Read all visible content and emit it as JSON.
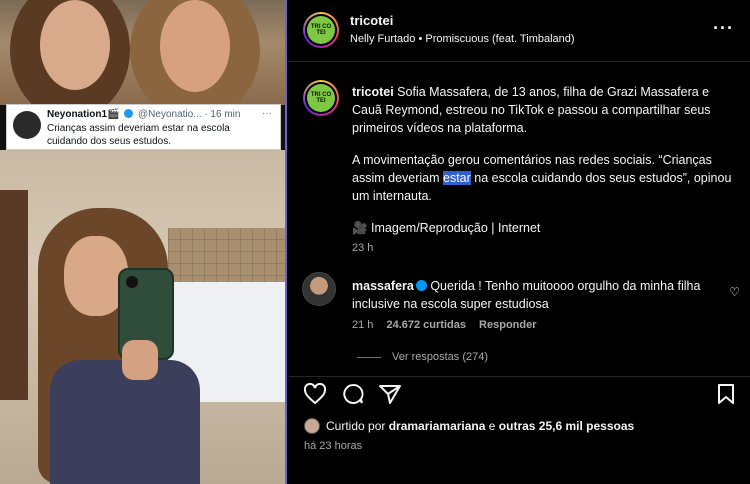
{
  "tweet": {
    "display_name": "Neyonation1",
    "display_name_emoji": "🎬",
    "handle": "@Neyonatio...",
    "time": "· 16 min",
    "more": "···",
    "text_line1": "Crianças assim deveriam estar na escola",
    "text_line2": "cuidando dos seus estudos."
  },
  "header": {
    "avatar_text": "TRI CO TEI",
    "username": "tricotei",
    "audio": "Nelly Furtado • Promiscuous (feat. Timbaland)",
    "more": "···"
  },
  "caption": {
    "username": "tricotei",
    "p1": " Sofia Massafera, de 13 anos, filha de Grazi Massafera e Cauã Reymond, estreou no TikTok e passou a compartilhar seus primeiros vídeos na plataforma.",
    "p2_before": "A movimentação gerou comentários nas redes sociais. “Crianças assim deveriam ",
    "p2_highlight": "estar",
    "p2_after": " na escola cuidando dos seus estudos”, opinou um internauta.",
    "p3_icon": "🎥",
    "p3": " Imagem/Reprodução | Internet",
    "time": "23 h"
  },
  "comment": {
    "username": "massafera",
    "text": " Querida ! Tenho muitoooo orgulho da minha filha inclusive na escola super estudiosa",
    "time": "21 h",
    "likes": "24.672 curtidas",
    "reply": "Responder",
    "view_replies": "Ver respostas (274)"
  },
  "likes": {
    "prefix": "Curtido por ",
    "user": "dramariamariana",
    "middle": " e ",
    "others": "outras 25,6 mil pessoas"
  },
  "posted_ago": "há 23 horas",
  "icons": {
    "like": "heart-icon",
    "comment": "comment-icon",
    "share": "share-icon",
    "save": "bookmark-icon"
  },
  "colors": {
    "highlight": "#2f5fd0",
    "verified": "#0095f6",
    "tricotei_logo": "#7ec843"
  }
}
